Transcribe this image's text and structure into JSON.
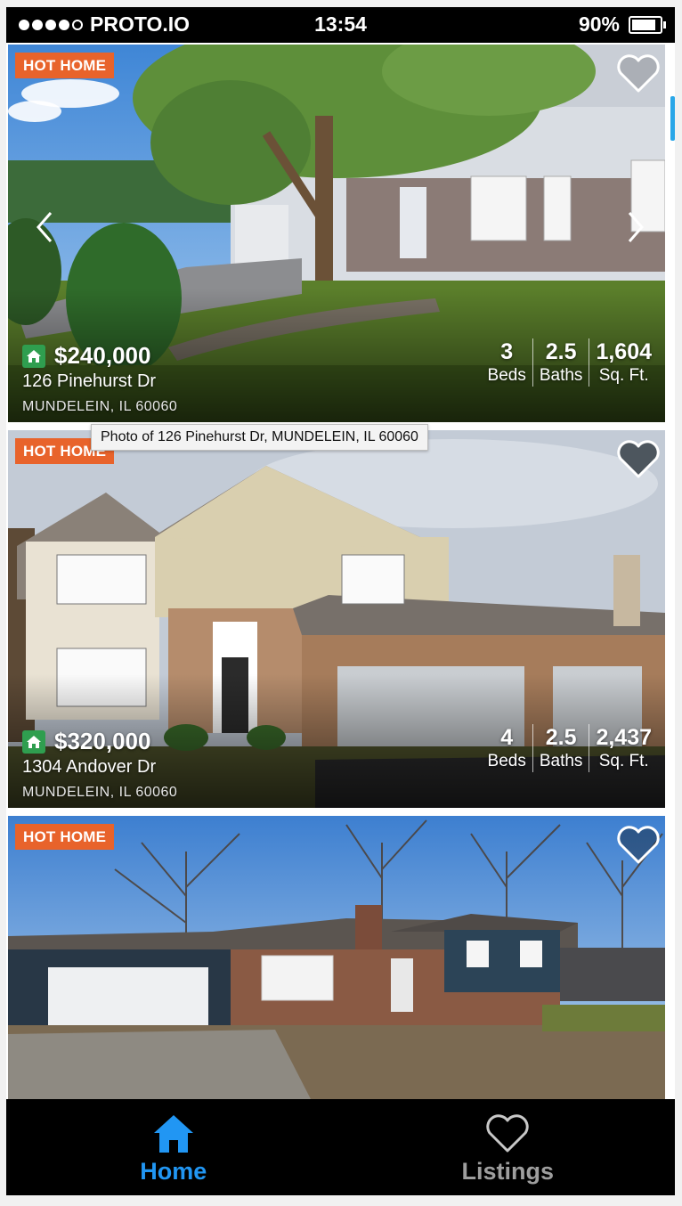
{
  "status_bar": {
    "carrier": "PROTO.IO",
    "time": "13:54",
    "battery": "90%"
  },
  "listings": [
    {
      "badge": "HOT HOME",
      "price": "$240,000",
      "street": "126 Pinehurst Dr",
      "city": "MUNDELEIN, IL 60060",
      "beds": "3",
      "beds_label": "Beds",
      "baths": "2.5",
      "baths_label": "Baths",
      "sqft": "1,604",
      "sqft_label": "Sq. Ft.",
      "favorited": false
    },
    {
      "badge": "HOT HOME",
      "price": "$320,000",
      "street": "1304 Andover Dr",
      "city": "MUNDELEIN, IL 60060",
      "beds": "4",
      "beds_label": "Beds",
      "baths": "2.5",
      "baths_label": "Baths",
      "sqft": "2,437",
      "sqft_label": "Sq. Ft.",
      "favorited": false
    },
    {
      "badge": "HOT HOME",
      "favorited": false
    }
  ],
  "tooltip": "Photo of 126 Pinehurst Dr, MUNDELEIN, IL 60060",
  "tabs": [
    {
      "label": "Home",
      "icon": "home-icon",
      "active": true
    },
    {
      "label": "Listings",
      "icon": "heart-icon",
      "active": false
    }
  ],
  "colors": {
    "hot_badge": "#e8632b",
    "home_badge": "#2f9e4f",
    "tab_active": "#2196f3",
    "tab_inactive": "#9e9e9e",
    "scroll_indicator": "#2aa7e8"
  }
}
